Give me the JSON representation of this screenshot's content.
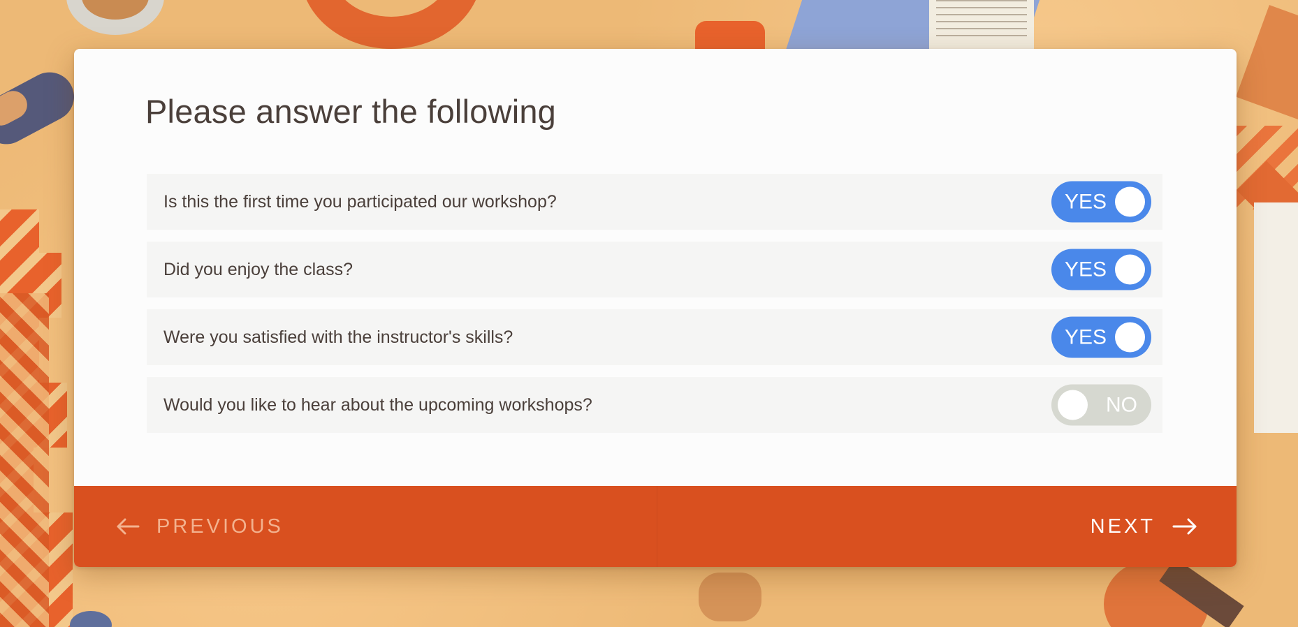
{
  "form": {
    "title": "Please answer the following",
    "questions": [
      {
        "text": "Is this the first time you participated our workshop?",
        "state": "YES",
        "on": true
      },
      {
        "text": "Did you enjoy the class?",
        "state": "YES",
        "on": true
      },
      {
        "text": "Were you satisfied with the instructor's skills?",
        "state": "YES",
        "on": true
      },
      {
        "text": "Would you like to hear about the upcoming workshops?",
        "state": "NO",
        "on": false
      }
    ]
  },
  "nav": {
    "previous_label": "PREVIOUS",
    "next_label": "NEXT",
    "previous_icon": "arrow-left-icon",
    "next_icon": "arrow-right-icon"
  },
  "colors": {
    "accent_orange": "#d9501f",
    "toggle_on": "#4a88ea",
    "toggle_off": "#d6d8d0",
    "background": "#edb976"
  }
}
